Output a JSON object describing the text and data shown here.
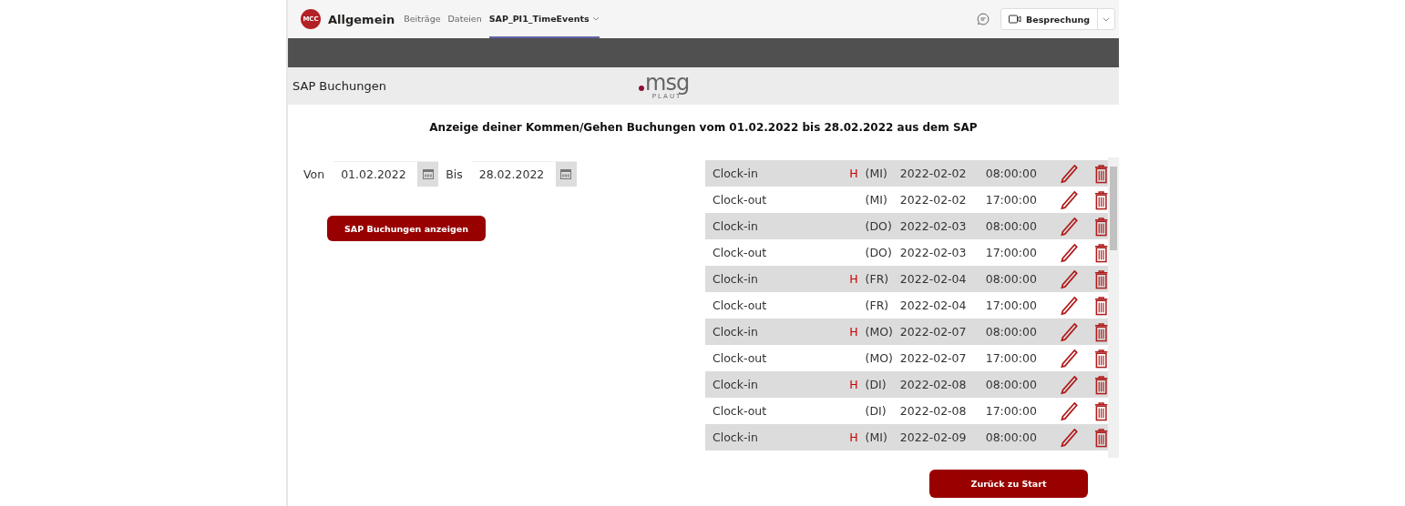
{
  "teams_header": {
    "avatar": "MCC",
    "channel": "Allgemein",
    "tabs": [
      {
        "label": "Beiträge",
        "selected": false
      },
      {
        "label": "Dateien",
        "selected": false
      },
      {
        "label": "SAP_PI1_TimeEvents",
        "selected": true,
        "dropdown": true
      }
    ],
    "meeting_button": "Besprechung"
  },
  "app_header": {
    "title": "SAP Buchungen",
    "logo": {
      "word": "msg",
      "sub": "PLAUT"
    }
  },
  "heading": "Anzeige deiner Kommen/Gehen Buchungen vom 01.02.2022 bis 28.02.2022 aus dem SAP",
  "filter": {
    "from_label": "Von",
    "from_value": "01.02.2022",
    "to_label": "Bis",
    "to_value": "28.02.2022",
    "button": "SAP Buchungen anzeigen"
  },
  "bookings": [
    {
      "type": "Clock-in",
      "marker": "H",
      "weekday": "(MI)",
      "date": "2022-02-02",
      "time": "08:00:00"
    },
    {
      "type": "Clock-out",
      "weekday": "(MI)",
      "date": "2022-02-02",
      "time": "17:00:00"
    },
    {
      "type": "Clock-in",
      "weekday": "(DO)",
      "date": "2022-02-03",
      "time": "08:00:00"
    },
    {
      "type": "Clock-out",
      "weekday": "(DO)",
      "date": "2022-02-03",
      "time": "17:00:00"
    },
    {
      "type": "Clock-in",
      "marker": "H",
      "weekday": "(FR)",
      "date": "2022-02-04",
      "time": "08:00:00"
    },
    {
      "type": "Clock-out",
      "weekday": "(FR)",
      "date": "2022-02-04",
      "time": "17:00:00"
    },
    {
      "type": "Clock-in",
      "marker": "H",
      "weekday": "(MO)",
      "date": "2022-02-07",
      "time": "08:00:00"
    },
    {
      "type": "Clock-out",
      "weekday": "(MO)",
      "date": "2022-02-07",
      "time": "17:00:00"
    },
    {
      "type": "Clock-in",
      "marker": "H",
      "weekday": "(DI)",
      "date": "2022-02-08",
      "time": "08:00:00"
    },
    {
      "type": "Clock-out",
      "weekday": "(DI)",
      "date": "2022-02-08",
      "time": "17:00:00"
    },
    {
      "type": "Clock-in",
      "marker": "H",
      "weekday": "(MI)",
      "date": "2022-02-09",
      "time": "08:00:00"
    }
  ],
  "back_button": "Zurück zu Start"
}
